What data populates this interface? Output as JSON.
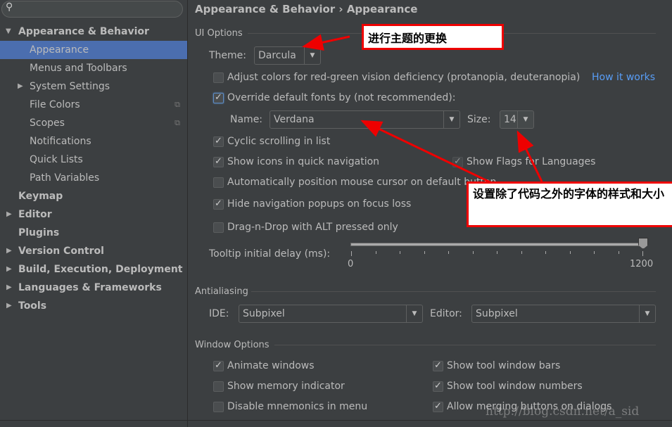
{
  "sidebar": {
    "search_placeholder": "",
    "items": [
      {
        "label": "Appearance & Behavior",
        "expanded": true
      },
      {
        "label": "Appearance",
        "selected": true
      },
      {
        "label": "Menus and Toolbars"
      },
      {
        "label": "System Settings"
      },
      {
        "label": "File Colors"
      },
      {
        "label": "Scopes"
      },
      {
        "label": "Notifications"
      },
      {
        "label": "Quick Lists"
      },
      {
        "label": "Path Variables"
      },
      {
        "label": "Keymap"
      },
      {
        "label": "Editor"
      },
      {
        "label": "Plugins"
      },
      {
        "label": "Version Control"
      },
      {
        "label": "Build, Execution, Deployment"
      },
      {
        "label": "Languages & Frameworks"
      },
      {
        "label": "Tools"
      }
    ]
  },
  "breadcrumb": "Appearance & Behavior › Appearance",
  "ui_options": {
    "title": "UI Options",
    "theme_label": "Theme:",
    "theme_value": "Darcula",
    "adjust_colors": "Adjust colors for red-green vision deficiency (protanopia, deuteranopia)",
    "how_it_works": "How it works",
    "override_fonts": "Override default fonts by (not recommended):",
    "name_label": "Name:",
    "name_value": "Verdana",
    "size_label": "Size:",
    "size_value": "14",
    "cyclic": "Cyclic scrolling in list",
    "show_icons": "Show icons in quick navigation",
    "show_flags": "Show Flags for Languages",
    "auto_mouse": "Automatically position mouse cursor on default button",
    "hide_popups": "Hide navigation popups on focus loss",
    "dnd_alt": "Drag-n-Drop with ALT pressed only",
    "tooltip_label": "Tooltip initial delay (ms):",
    "tooltip_min": "0",
    "tooltip_max": "1200",
    "tooltip_value": 1200
  },
  "antialiasing": {
    "title": "Antialiasing",
    "ide_label": "IDE:",
    "ide_value": "Subpixel",
    "editor_label": "Editor:",
    "editor_value": "Subpixel"
  },
  "window_options": {
    "title": "Window Options",
    "animate": "Animate windows",
    "memory": "Show memory indicator",
    "mnemonics": "Disable mnemonics in menu",
    "tool_bars": "Show tool window bars",
    "tool_numbers": "Show tool window numbers",
    "merging": "Allow merging buttons on dialogs"
  },
  "annotations": {
    "theme_note": "进行主题的更换",
    "font_note": "设置除了代码之外的字体的样式和大小"
  },
  "watermark": "http://blog.csdn.net/a_sid",
  "colors": {
    "selection": "#4b6eaf",
    "link": "#589df6",
    "annotation": "#ee0000"
  }
}
